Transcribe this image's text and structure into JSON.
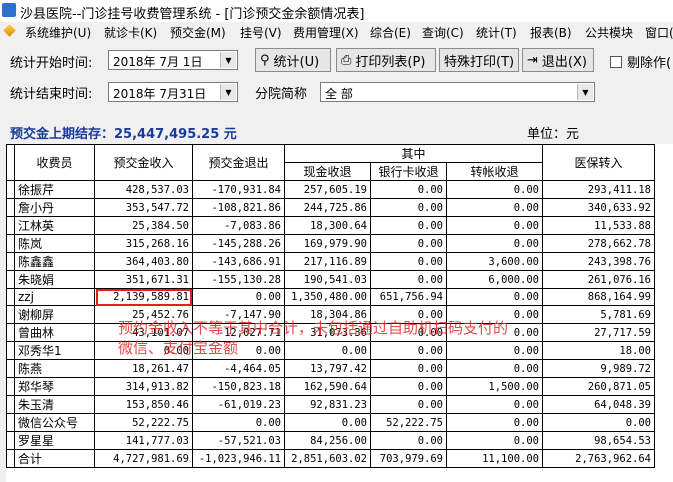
{
  "window": {
    "title": "沙县医院--门诊挂号收费管理系统 - [门诊预交金余额情况表]"
  },
  "menu": [
    "系统维护(U)",
    "就诊卡(K)",
    "预交金(M)",
    "挂号(V)",
    "费用管理(X)",
    "综合(E)",
    "查询(C)",
    "统计(T)",
    "报表(B)",
    "公共模块",
    "窗口("
  ],
  "filters": {
    "start_label": "统计开始时间:",
    "start_value": "2018年  7月  1日",
    "end_label": "统计结束时间:",
    "end_value": "2018年  7月31日",
    "branch_label": "分院简称",
    "branch_value": "全  部"
  },
  "buttons": {
    "stat": "统计(U)",
    "print_list": "打印列表(P)",
    "special_print": "特殊打印(T)",
    "exit": "退出(X)",
    "remove_label": "剔除作("
  },
  "info": {
    "carry_over": "预交金上期结存：25,447,495.25 元",
    "unit": "单位：元"
  },
  "table": {
    "headers": {
      "cashier": "收费员",
      "deposit_in": "预交金收入",
      "deposit_out": "预交金退出",
      "group": "其中",
      "cash": "现金收退",
      "bankcard": "银行卡收退",
      "transfer": "转帐收退",
      "insurance": "医保转入"
    },
    "rows": [
      [
        "徐振芹",
        "428,537.03",
        "-170,931.84",
        "257,605.19",
        "0.00",
        "0.00",
        "293,411.18"
      ],
      [
        "詹小丹",
        "353,547.72",
        "-108,821.86",
        "244,725.86",
        "0.00",
        "0.00",
        "340,633.92"
      ],
      [
        "江林英",
        "25,384.50",
        "-7,083.86",
        "18,300.64",
        "0.00",
        "0.00",
        "11,533.88"
      ],
      [
        "陈岚",
        "315,268.16",
        "-145,288.26",
        "169,979.90",
        "0.00",
        "0.00",
        "278,662.78"
      ],
      [
        "陈鑫鑫",
        "364,403.80",
        "-143,686.91",
        "217,116.89",
        "0.00",
        "3,600.00",
        "243,398.76"
      ],
      [
        "朱晓娟",
        "351,671.31",
        "-155,130.28",
        "190,541.03",
        "0.00",
        "6,000.00",
        "261,076.16"
      ],
      [
        "zzj",
        "2,139,589.81",
        "0.00",
        "1,350,480.00",
        "651,756.94",
        "0.00",
        "868,164.99"
      ],
      [
        "谢柳屏",
        "25,452.76",
        "-7,147.90",
        "18,304.86",
        "0.00",
        "0.00",
        "5,781.69"
      ],
      [
        "曾曲林",
        "43,101.07",
        "-12,027.71",
        "31,073.36",
        "0.00",
        "0.00",
        "27,717.59"
      ],
      [
        "邓秀华1",
        "0.00",
        "0.00",
        "0.00",
        "0.00",
        "0.00",
        "18.00"
      ],
      [
        "陈燕",
        "18,261.47",
        "-4,464.05",
        "13,797.42",
        "0.00",
        "0.00",
        "9,989.72"
      ],
      [
        "郑华琴",
        "314,913.82",
        "-150,823.18",
        "162,590.64",
        "0.00",
        "1,500.00",
        "260,871.05"
      ],
      [
        "朱玉清",
        "153,850.46",
        "-61,019.23",
        "92,831.23",
        "0.00",
        "0.00",
        "64,048.39"
      ],
      [
        "微信公众号",
        "52,222.75",
        "0.00",
        "0.00",
        "52,222.75",
        "0.00",
        "0.00"
      ],
      [
        "罗星星",
        "141,777.03",
        "-57,521.03",
        "84,256.00",
        "0.00",
        "0.00",
        "98,654.53"
      ],
      [
        "合计",
        "4,727,981.69",
        "-1,023,946.11",
        "2,851,603.02",
        "703,979.69",
        "11,100.00",
        "2,763,962.64"
      ]
    ]
  },
  "annotation": {
    "line1": "预约金收入不等于其中合计，未包括通过自助机扫码支付的",
    "line2": "微信、支付宝金额"
  },
  "colors": {
    "highlight": "#e02020",
    "carry_text": "#1a3a9a",
    "annotation": "#e02a2a"
  },
  "icons": [
    "binoculars-icon",
    "printer-icon",
    "exit-door-icon",
    "checkbox-icon",
    "dropdown-arrow-icon"
  ]
}
